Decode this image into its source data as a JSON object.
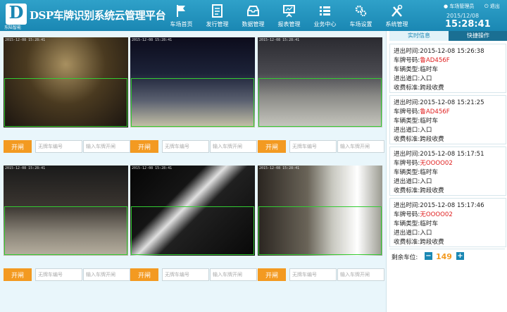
{
  "header": {
    "logo_letter": "D",
    "logo_sub": "东陆智能",
    "app_title": "DSP车牌识别系统云管理平台",
    "nav": [
      {
        "label": "车场首页",
        "icon": "flag-icon"
      },
      {
        "label": "发行管理",
        "icon": "document-icon"
      },
      {
        "label": "数据管理",
        "icon": "inbox-icon"
      },
      {
        "label": "报表管理",
        "icon": "presentation-icon"
      },
      {
        "label": "业务中心",
        "icon": "list-icon"
      },
      {
        "label": "车场设置",
        "icon": "gears-icon"
      },
      {
        "label": "系统管理",
        "icon": "tools-icon"
      }
    ],
    "user": "车场管理员",
    "logout": "退出",
    "date": "2015/12/08",
    "time": "15:28:41"
  },
  "cameras": [
    {
      "stamp": "2015-12-08 15:28:41",
      "open_label": "开闸",
      "plate_placeholder": "无牌车编号",
      "input_placeholder": "输入车牌开闸"
    },
    {
      "stamp": "2015-12-08 15:28:41",
      "open_label": "开闸",
      "plate_placeholder": "无牌车编号",
      "input_placeholder": "输入车牌开闸"
    },
    {
      "stamp": "2015-12-08 15:28:41",
      "open_label": "开闸",
      "plate_placeholder": "无牌车编号",
      "input_placeholder": "输入车牌开闸"
    },
    {
      "stamp": "2015-12-08 15:28:41",
      "open_label": "开闸",
      "plate_placeholder": "无牌车编号",
      "input_placeholder": "输入车牌开闸"
    },
    {
      "stamp": "2015-12-08 15:28:41",
      "open_label": "开闸",
      "plate_placeholder": "无牌车编号",
      "input_placeholder": "输入车牌开闸"
    },
    {
      "stamp": "2015-12-08 15:28:41",
      "open_label": "开闸",
      "plate_placeholder": "无牌车编号",
      "input_placeholder": "输入车牌开闸"
    }
  ],
  "side": {
    "tab_realtime": "实时信息",
    "tab_quick": "快捷操作",
    "records": [
      {
        "time": "进出时间:2015-12-08 15:26:38",
        "plate_label": "车牌号码:",
        "plate": "鲁AD456F",
        "type": "车辆类型:临时车",
        "gate": "进出道口:入口",
        "fee": "收费标准:跨段收费"
      },
      {
        "time": "进出时间:2015-12-08 15:21:25",
        "plate_label": "车牌号码:",
        "plate": "鲁AD456F",
        "type": "车辆类型:临时车",
        "gate": "进出道口:入口",
        "fee": "收费标准:跨段收费"
      },
      {
        "time": "进出时间:2015-12-08 15:17:51",
        "plate_label": "车牌号码:",
        "plate": "无OOOO02",
        "type": "车辆类型:临时车",
        "gate": "进出道口:入口",
        "fee": "收费标准:跨段收费"
      },
      {
        "time": "进出时间:2015-12-08 15:17:46",
        "plate_label": "车牌号码:",
        "plate": "无OOOO02",
        "type": "车辆类型:临时车",
        "gate": "进出道口:入口",
        "fee": "收费标准:跨段收费"
      }
    ],
    "remaining_label": "剩余车位:",
    "remaining_count": "149",
    "minus": "−",
    "plus": "+"
  },
  "colors": {
    "header": "#1a87b3",
    "accent": "#f39a21",
    "plate_red": "#e02020"
  }
}
